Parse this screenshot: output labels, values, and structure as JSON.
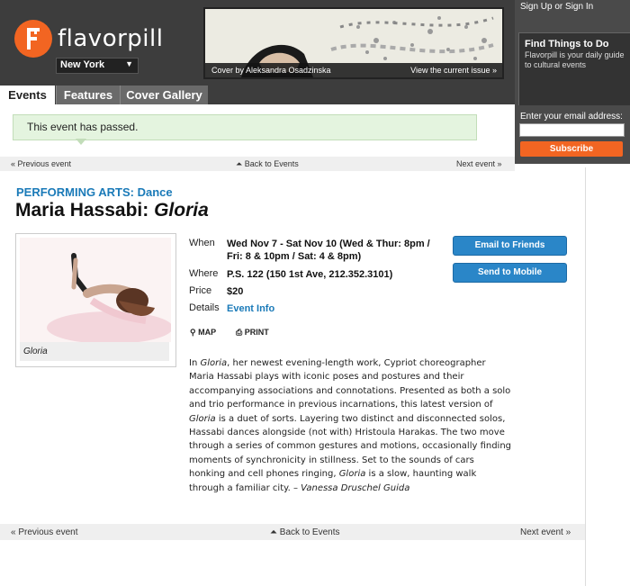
{
  "header": {
    "logo": "flavorpill",
    "city": "New York",
    "cover_credit": "Cover by Aleksandra Osadzinska",
    "cover_link": "View the current issue »"
  },
  "tabs": [
    {
      "label": "Events",
      "active": true
    },
    {
      "label": "Features",
      "active": false
    },
    {
      "label": "Cover Gallery",
      "active": false
    }
  ],
  "sidebar": {
    "sign_in": "Sign Up or Sign In",
    "find_title": "Find Things to Do",
    "find_desc": "Flavorpill is your daily guide to cultural events",
    "email_label": "Enter your email address:",
    "email_value": "",
    "subscribe": "Subscribe"
  },
  "notice": "This event has passed.",
  "nav": {
    "prev": "« Previous event",
    "back": "Back to Events",
    "next": "Next event »"
  },
  "event": {
    "category": "PERFORMING ARTS: Dance",
    "title": "Maria Hassabi: ",
    "title_italic": "Gloria",
    "photo_caption": "Gloria",
    "when_label": "When",
    "when": "Wed Nov 7 - Sat Nov 10 (Wed & Thur: 8pm / Fri: 8 & 10pm / Sat: 4 & 8pm)",
    "where_label": "Where",
    "where": "P.S. 122 (150 1st Ave, 212.352.3101)",
    "price_label": "Price",
    "price": "$20",
    "details_label": "Details",
    "details": "Event Info",
    "email_friends": "Email to Friends",
    "send_mobile": "Send to Mobile",
    "map": "MAP",
    "print": "PRINT",
    "description": [
      {
        "t": "In ",
        "i": false
      },
      {
        "t": "Gloria",
        "i": true
      },
      {
        "t": ", her newest evening-length work, Cypriot choreographer Maria Hassabi plays with iconic poses and postures and their accompanying associations and connotations. Presented as both a solo and trio performance in previous incarnations, this latest version of ",
        "i": false
      },
      {
        "t": "Gloria",
        "i": true
      },
      {
        "t": " is a duet of sorts. Layering two distinct and disconnected solos, Hassabi dances alongside (not with) Hristoula Harakas. The two move through a series of common gestures and motions, occasionally finding moments of synchronicity in stillness. Set to the sounds of cars honking and cell phones ringing, ",
        "i": false
      },
      {
        "t": "Gloria",
        "i": true
      },
      {
        "t": " is a slow, haunting walk through a familiar city. – ",
        "i": false
      },
      {
        "t": "Vanessa Druschel Guida",
        "i": true
      }
    ]
  },
  "colors": {
    "brand_orange": "#f26522",
    "link_blue": "#1a7ab8",
    "header_dark": "#3d3d3d",
    "notice_green": "#e4f4df"
  }
}
